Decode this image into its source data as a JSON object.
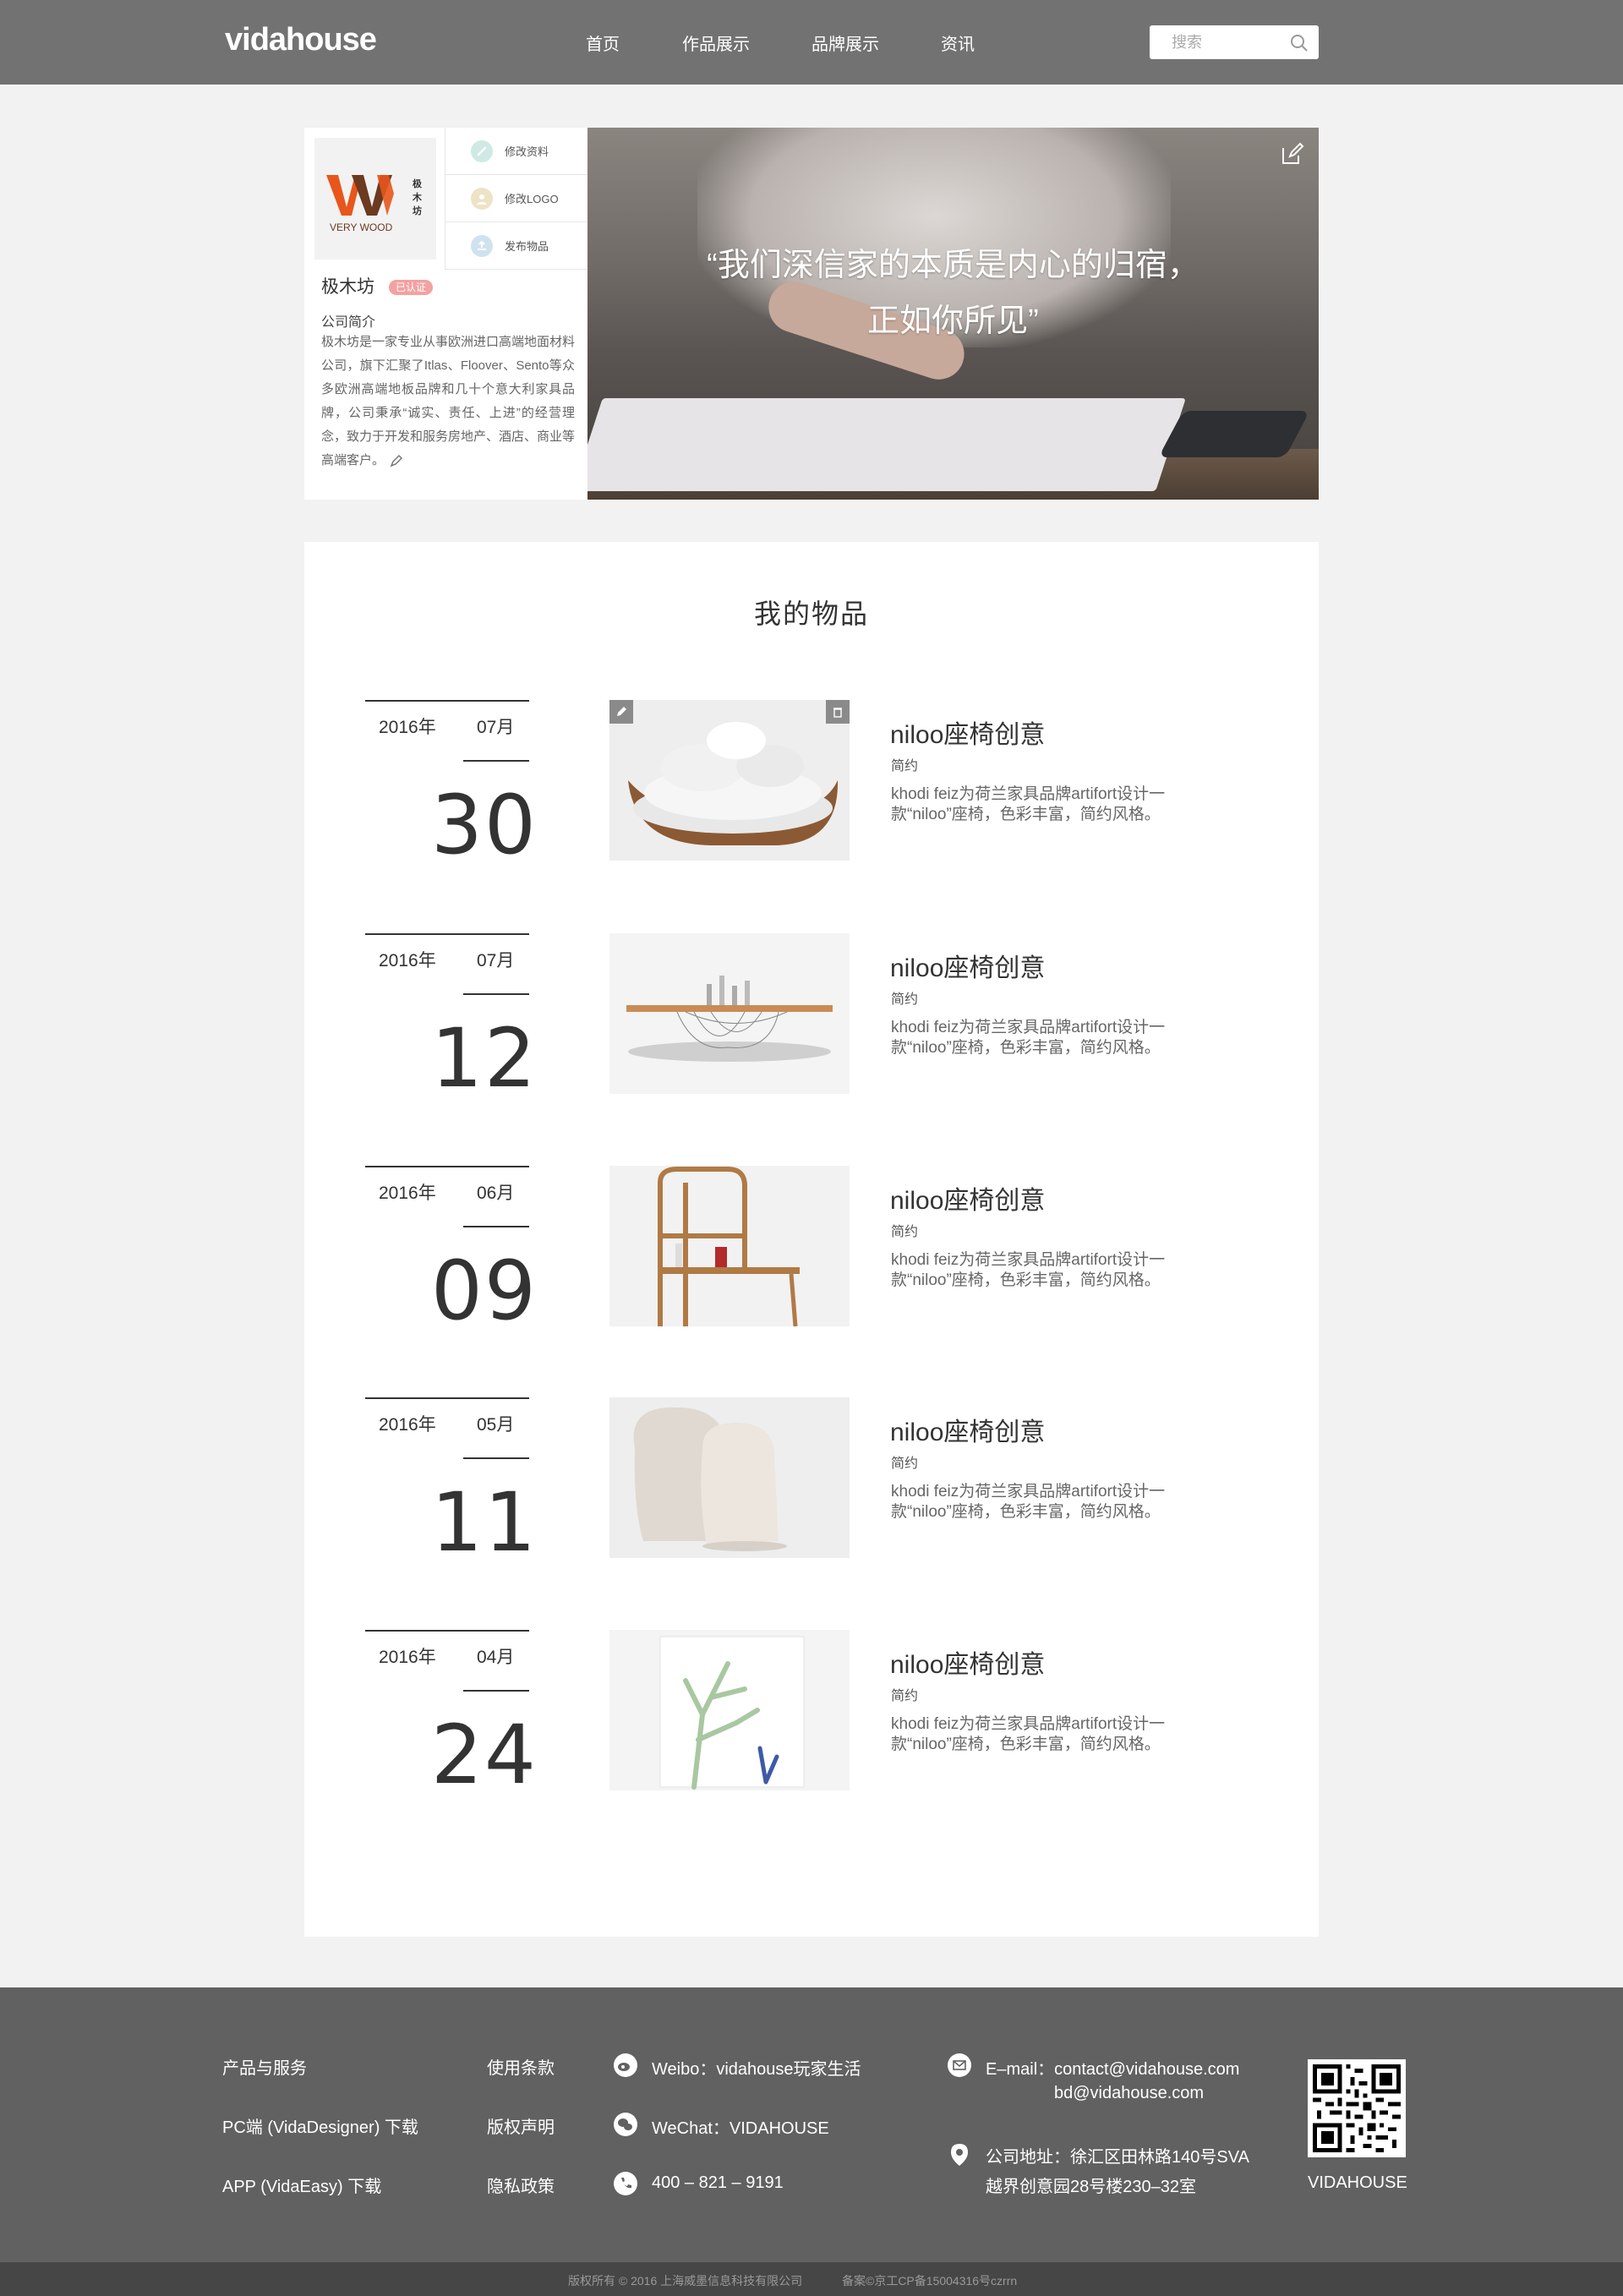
{
  "header": {
    "logo": "vidahouse",
    "nav": [
      "首页",
      "作品展示",
      "品牌展示",
      "资讯"
    ],
    "search_placeholder": "搜索"
  },
  "profile": {
    "logo_text": "VERY WOOD",
    "logo_cn": "极木坊",
    "actions": [
      "修改资料",
      "修改LOGO",
      "发布物品"
    ],
    "name": "极木坊",
    "badge": "已认证",
    "intro_label": "公司简介",
    "intro": "极木坊是一家专业从事欧洲进口高端地面材料公司，旗下汇聚了Itlas、Floover、Sento等众多欧洲高端地板品牌和几十个意大利家具品牌，公司秉承“诚实、责任、上进”的经营理念，致力于开发和服务房地产、酒店、商业等高端客户。"
  },
  "banner": {
    "quote_line1": "“我们深信家的本质是内心的归宿，",
    "quote_line2": "正如你所见”"
  },
  "main": {
    "title": "我的物品",
    "items": [
      {
        "year": "2016年",
        "month": "07月",
        "day": "30",
        "title": "niloo座椅创意",
        "sub": "简约",
        "desc": "khodi feiz为荷兰家具品牌artifort设计一款“niloo”座椅，色彩丰富，简约风格。"
      },
      {
        "year": "2016年",
        "month": "07月",
        "day": "12",
        "title": "niloo座椅创意",
        "sub": "简约",
        "desc": "khodi feiz为荷兰家具品牌artifort设计一款“niloo”座椅，色彩丰富，简约风格。"
      },
      {
        "year": "2016年",
        "month": "06月",
        "day": "09",
        "title": "niloo座椅创意",
        "sub": "简约",
        "desc": "khodi feiz为荷兰家具品牌artifort设计一款“niloo”座椅，色彩丰富，简约风格。"
      },
      {
        "year": "2016年",
        "month": "05月",
        "day": "11",
        "title": "niloo座椅创意",
        "sub": "简约",
        "desc": "khodi feiz为荷兰家具品牌artifort设计一款“niloo”座椅，色彩丰富，简约风格。"
      },
      {
        "year": "2016年",
        "month": "04月",
        "day": "24",
        "title": "niloo座椅创意",
        "sub": "简约",
        "desc": "khodi feiz为荷兰家具品牌artifort设计一款“niloo”座椅，色彩丰富，简约风格。"
      }
    ]
  },
  "footer": {
    "col1": [
      "产品与服务",
      "PC端 (VidaDesigner) 下载",
      "APP (VidaEasy) 下载"
    ],
    "col2": [
      "使用条款",
      "版权声明",
      "隐私政策"
    ],
    "weibo": "Weibo：vidahouse玩家生活",
    "wechat": "WeChat：VIDAHOUSE",
    "phone": "400 – 821 – 9191",
    "email1": "E–mail：contact@vidahouse.com",
    "email2": "bd@vidahouse.com",
    "address1": "公司地址：徐汇区田林路140号SVA",
    "address2": "越界创意园28号楼230–32室",
    "qr_label": "VIDAHOUSE",
    "copyright": "版权所有 © 2016 上海威墨信息科技有限公司",
    "icp": "备案©京工CP备15004316号czrrn"
  }
}
